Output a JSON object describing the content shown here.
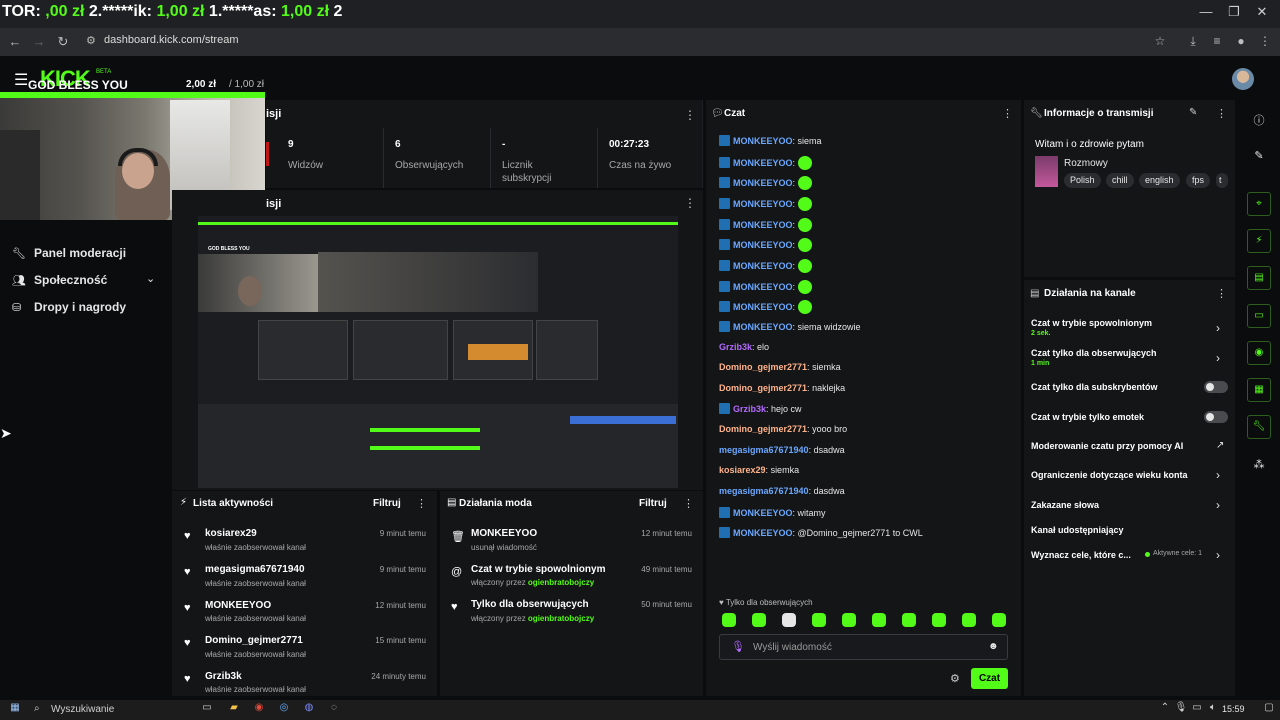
{
  "browser": {
    "tab_overlay_text_parts": [
      "TOR: ",
      ",00 zł",
      " 2.",
      "*****ik: ",
      "1,00 zł",
      " 1.",
      "*****as: ",
      "1,00 zł",
      " 2"
    ],
    "url": "dashboard.kick.com/stream",
    "window_controls": [
      "minimize-icon",
      "maximize-icon",
      "close-icon"
    ]
  },
  "header": {
    "logo": "KICK",
    "beta": "BETA"
  },
  "overlay": {
    "goal_title": "GOD BLESS YOU",
    "goal_current": "2,00 zł",
    "goal_target": "/ 1,00 zł",
    "goal_progress": 1.0
  },
  "stats": {
    "title": "isji",
    "items": [
      {
        "value": "9",
        "label": "Widzów"
      },
      {
        "value": "6",
        "label": "Obserwujących"
      },
      {
        "value": "-",
        "label": "Licznik subskrypcji"
      },
      {
        "value": "00:27:23",
        "label": "Czas na żywo"
      }
    ]
  },
  "preview": {
    "title": "isji"
  },
  "left_nav": {
    "items": [
      {
        "label": "Panel moderacji",
        "icon": "wrench-icon"
      },
      {
        "label": "Społeczność",
        "icon": "people-icon"
      },
      {
        "label": "Dropy i nagrody",
        "icon": "gift-icon"
      }
    ]
  },
  "activity": {
    "title": "Lista aktywności",
    "filter": "Filtruj",
    "items": [
      {
        "name": "kosiarex29",
        "sub": "właśnie zaobserwował kanał",
        "time": "9 minut temu"
      },
      {
        "name": "megasigma67671940",
        "sub": "właśnie zaobserwował kanał",
        "time": "9 minut temu"
      },
      {
        "name": "MONKEEYOO",
        "sub": "właśnie zaobserwował kanał",
        "time": "12 minut temu"
      },
      {
        "name": "Domino_gejmer2771",
        "sub": "właśnie zaobserwował kanał",
        "time": "15 minut temu"
      },
      {
        "name": "Grzib3k",
        "sub": "właśnie zaobserwował kanał",
        "time": "24 minuty temu"
      }
    ]
  },
  "mod_actions": {
    "title": "Działania moda",
    "filter": "Filtruj",
    "items": [
      {
        "name": "MONKEEYOO",
        "sub": "usunął wiadomość",
        "by": "",
        "time": "12 minut temu",
        "icon": "trash-icon"
      },
      {
        "name": "Czat w trybie spowolnionym",
        "sub": "włączony przez",
        "by": "ogienbratobojczy",
        "time": "49 minut temu",
        "icon": "snail-icon"
      },
      {
        "name": "Tylko dla obserwujących",
        "sub": "włączony przez",
        "by": "ogienbratobojczy",
        "time": "50 minut temu",
        "icon": "heart-icon"
      }
    ]
  },
  "chat": {
    "title": "Czat",
    "messages": [
      {
        "user": "MONKEEYOO",
        "color": "blue",
        "badge": true,
        "text": "siema",
        "emote": false
      },
      {
        "user": "MONKEEYOO",
        "color": "blue",
        "badge": true,
        "text": "",
        "emote": true
      },
      {
        "user": "MONKEEYOO",
        "color": "blue",
        "badge": true,
        "text": "",
        "emote": true
      },
      {
        "user": "MONKEEYOO",
        "color": "blue",
        "badge": true,
        "text": "",
        "emote": true
      },
      {
        "user": "MONKEEYOO",
        "color": "blue",
        "badge": true,
        "text": "",
        "emote": true
      },
      {
        "user": "MONKEEYOO",
        "color": "blue",
        "badge": true,
        "text": "",
        "emote": true
      },
      {
        "user": "MONKEEYOO",
        "color": "blue",
        "badge": true,
        "text": "",
        "emote": true
      },
      {
        "user": "MONKEEYOO",
        "color": "blue",
        "badge": true,
        "text": "",
        "emote": true
      },
      {
        "user": "MONKEEYOO",
        "color": "blue",
        "badge": true,
        "text": "",
        "emote": true
      },
      {
        "user": "MONKEEYOO",
        "color": "blue",
        "badge": true,
        "text": "siema widzowie",
        "emote": false
      },
      {
        "user": "Grzib3k",
        "color": "purple",
        "badge": false,
        "text": "elo",
        "emote": false
      },
      {
        "user": "Domino_gejmer2771",
        "color": "peach",
        "badge": false,
        "text": "siemka",
        "emote": false
      },
      {
        "user": "Domino_gejmer2771",
        "color": "peach",
        "badge": false,
        "text": "naklejka",
        "emote": false
      },
      {
        "user": "Grzib3k",
        "color": "purple",
        "badge": true,
        "text": "hejo cw",
        "emote": false
      },
      {
        "user": "Domino_gejmer2771",
        "color": "peach",
        "badge": false,
        "text": "yooo bro",
        "emote": false
      },
      {
        "user": "megasigma67671940",
        "color": "blue",
        "badge": false,
        "text": "dsadwa",
        "emote": false
      },
      {
        "user": "kosiarex29",
        "color": "peach",
        "badge": false,
        "text": "siemka",
        "emote": false
      },
      {
        "user": "megasigma67671940",
        "color": "blue",
        "badge": false,
        "text": "dasdwa",
        "emote": false
      },
      {
        "user": "MONKEEYOO",
        "color": "blue",
        "badge": true,
        "text": "witamy",
        "emote": false
      },
      {
        "user": "MONKEEYOO",
        "color": "blue",
        "badge": true,
        "text": "@Domino_gejmer2771 to CWL",
        "emote": false
      }
    ],
    "follow_only": "Tylko dla obserwujących",
    "input_placeholder": "Wyślij wiadomość",
    "send_label": "Czat"
  },
  "stream_info": {
    "title": "Informacje o transmisji",
    "stream_title": "Witam i o zdrowie pytam",
    "category": "Rozmowy",
    "tags": [
      "Polish",
      "chill",
      "english",
      "fps",
      "t"
    ]
  },
  "channel_actions": {
    "title": "Działania na kanale",
    "items": [
      {
        "label": "Czat w trybie spowolnionym",
        "sub": "2 sek.",
        "control": "chevron"
      },
      {
        "label": "Czat tylko dla obserwujących",
        "sub": "1 min",
        "control": "chevron"
      },
      {
        "label": "Czat tylko dla subskrybentów",
        "sub": "",
        "control": "toggle"
      },
      {
        "label": "Czat w trybie tylko emotek",
        "sub": "",
        "control": "toggle"
      },
      {
        "label": "Moderowanie czatu przy pomocy AI",
        "sub": "",
        "control": "external"
      },
      {
        "label": "Ograniczenie dotyczące wieku konta",
        "sub": "",
        "control": "chevron"
      },
      {
        "label": "Zakazane słowa",
        "sub": "",
        "control": "chevron"
      },
      {
        "label": "Kanał udostępniający",
        "sub": "",
        "control": "none"
      },
      {
        "label": "Wyznacz cele, które c...",
        "sub": "",
        "control": "chevron"
      }
    ],
    "goals_active": "Aktywne cele: 1"
  },
  "taskbar": {
    "search": "Wyszukiwanie",
    "time": "15:59"
  },
  "colors": {
    "accent": "#53fc18",
    "panel": "#141517",
    "background": "#0b0c0e"
  }
}
